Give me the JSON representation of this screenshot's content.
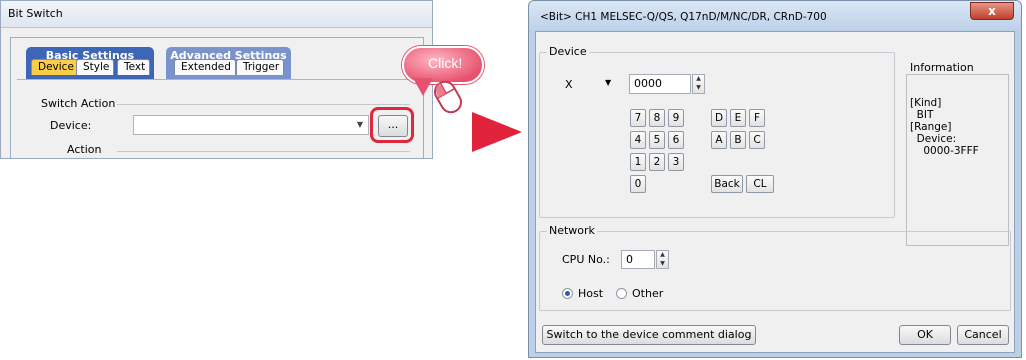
{
  "bit_switch": {
    "title": "Bit Switch",
    "tab_groups": [
      {
        "label": "Basic Settings",
        "tabs": [
          "Device",
          "Style",
          "Text"
        ]
      },
      {
        "label": "Advanced Settings",
        "tabs": [
          "Extended",
          "Trigger"
        ]
      }
    ],
    "active_tab": "Device",
    "switch_action_label": "Switch Action",
    "device_label": "Device:",
    "device_value": "",
    "browse_button": "...",
    "action_label": "Action"
  },
  "callout": {
    "text": "Click!",
    "color": "#e6526d"
  },
  "dialog": {
    "title": "<Bit> CH1 MELSEC-Q/QS, Q17nD/M/NC/DR, CRnD-700",
    "close_label": "x",
    "device_group_label": "Device",
    "device_type": "X",
    "device_number": "0000",
    "keypad": {
      "digits": [
        "7",
        "8",
        "9",
        "4",
        "5",
        "6",
        "1",
        "2",
        "3",
        "0"
      ],
      "hex": [
        "D",
        "E",
        "F",
        "A",
        "B",
        "C"
      ],
      "back": "Back",
      "clear": "CL"
    },
    "information": {
      "title": "Information",
      "lines": [
        "[Kind]",
        "  BIT",
        "[Range]",
        "  Device:",
        "    0000-3FFF"
      ]
    },
    "network_group_label": "Network",
    "cpu_no_label": "CPU No.:",
    "cpu_no_value": "0",
    "host_label": "Host",
    "other_label": "Other",
    "selected_station": "Host",
    "switch_button": "Switch to the device comment dialog",
    "ok_button": "OK",
    "cancel_button": "Cancel"
  },
  "colors": {
    "highlight": "#e0283c",
    "arrow": "#e0223a",
    "active_tab": "#f8cf46",
    "basic_group": "#3e66b6",
    "advanced_group": "#7b93cd"
  }
}
